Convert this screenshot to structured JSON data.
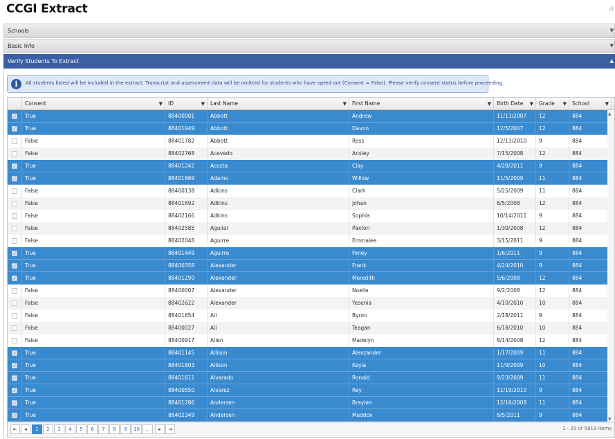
{
  "app": {
    "title": "CCGI Extract"
  },
  "sections": [
    {
      "label": "Schools"
    },
    {
      "label": "Basic Info"
    },
    {
      "label": "Verify Students To Extract"
    }
  ],
  "info": {
    "message": "All students listed will be included in the extract. Transcript and assessment data will be omitted for students who have opted out (Consent = False). Please verify consent status before proceeding."
  },
  "columns": [
    "Consent",
    "ID",
    "Last Name",
    "First Name",
    "Birth Date",
    "Grade",
    "School"
  ],
  "rows": [
    {
      "sel": true,
      "consent": "True",
      "id": "88400001",
      "last": "Abbott",
      "first": "Andrew",
      "birth": "11/11/2007",
      "grade": "12",
      "school": "884"
    },
    {
      "sel": true,
      "consent": "True",
      "id": "88401949",
      "last": "Abbott",
      "first": "Davon",
      "birth": "12/5/2007",
      "grade": "12",
      "school": "884"
    },
    {
      "sel": false,
      "consent": "False",
      "id": "88401782",
      "last": "Abbott",
      "first": "Ross",
      "birth": "12/13/2010",
      "grade": "9",
      "school": "884"
    },
    {
      "sel": false,
      "consent": "False",
      "id": "88402768",
      "last": "Acevedo",
      "first": "Ansley",
      "birth": "7/15/2008",
      "grade": "12",
      "school": "884"
    },
    {
      "sel": true,
      "consent": "True",
      "id": "88401242",
      "last": "Acosta",
      "first": "Clay",
      "birth": "4/28/2011",
      "grade": "9",
      "school": "884"
    },
    {
      "sel": true,
      "consent": "True",
      "id": "88401869",
      "last": "Adams",
      "first": "Willow",
      "birth": "11/5/2009",
      "grade": "11",
      "school": "884"
    },
    {
      "sel": false,
      "consent": "False",
      "id": "88400138",
      "last": "Adkins",
      "first": "Clark",
      "birth": "5/25/2009",
      "grade": "11",
      "school": "884"
    },
    {
      "sel": false,
      "consent": "False",
      "id": "88401692",
      "last": "Adkins",
      "first": "Johan",
      "birth": "8/5/2008",
      "grade": "12",
      "school": "884"
    },
    {
      "sel": false,
      "consent": "False",
      "id": "88402166",
      "last": "Adkins",
      "first": "Sophia",
      "birth": "10/14/2011",
      "grade": "9",
      "school": "884"
    },
    {
      "sel": false,
      "consent": "False",
      "id": "88402585",
      "last": "Aguilar",
      "first": "Paxton",
      "birth": "1/30/2008",
      "grade": "12",
      "school": "884"
    },
    {
      "sel": false,
      "consent": "False",
      "id": "88402048",
      "last": "Aguirre",
      "first": "Emmalee",
      "birth": "3/15/2011",
      "grade": "9",
      "school": "884"
    },
    {
      "sel": true,
      "consent": "True",
      "id": "88401449",
      "last": "Aguirre",
      "first": "Finley",
      "birth": "1/6/2011",
      "grade": "9",
      "school": "884"
    },
    {
      "sel": true,
      "consent": "True",
      "id": "88400358",
      "last": "Alexander",
      "first": "Frank",
      "birth": "4/24/2010",
      "grade": "9",
      "school": "884"
    },
    {
      "sel": true,
      "consent": "True",
      "id": "88401290",
      "last": "Alexander",
      "first": "Meredith",
      "birth": "5/6/2008",
      "grade": "12",
      "school": "884"
    },
    {
      "sel": false,
      "consent": "False",
      "id": "88400007",
      "last": "Alexander",
      "first": "Noelle",
      "birth": "9/2/2008",
      "grade": "12",
      "school": "884"
    },
    {
      "sel": false,
      "consent": "False",
      "id": "88402622",
      "last": "Alexander",
      "first": "Yesenia",
      "birth": "4/10/2010",
      "grade": "10",
      "school": "884"
    },
    {
      "sel": false,
      "consent": "False",
      "id": "88401654",
      "last": "Ali",
      "first": "Byron",
      "birth": "2/18/2011",
      "grade": "9",
      "school": "884"
    },
    {
      "sel": false,
      "consent": "False",
      "id": "88400027",
      "last": "Ali",
      "first": "Teagan",
      "birth": "6/18/2010",
      "grade": "10",
      "school": "884"
    },
    {
      "sel": false,
      "consent": "False",
      "id": "88400917",
      "last": "Allen",
      "first": "Madelyn",
      "birth": "8/14/2008",
      "grade": "12",
      "school": "884"
    },
    {
      "sel": true,
      "consent": "True",
      "id": "88401145",
      "last": "Allison",
      "first": "Alexzander",
      "birth": "1/17/2009",
      "grade": "11",
      "school": "884"
    },
    {
      "sel": true,
      "consent": "True",
      "id": "88401803",
      "last": "Allison",
      "first": "Keyla",
      "birth": "11/9/2009",
      "grade": "10",
      "school": "884"
    },
    {
      "sel": true,
      "consent": "True",
      "id": "88401611",
      "last": "Alvarado",
      "first": "Ronald",
      "birth": "9/23/2009",
      "grade": "11",
      "school": "884"
    },
    {
      "sel": true,
      "consent": "True",
      "id": "88400550",
      "last": "Alvarez",
      "first": "Rey",
      "birth": "11/19/2010",
      "grade": "9",
      "school": "884"
    },
    {
      "sel": true,
      "consent": "True",
      "id": "88401286",
      "last": "Andersen",
      "first": "Braylen",
      "birth": "12/16/2008",
      "grade": "11",
      "school": "884"
    },
    {
      "sel": true,
      "consent": "True",
      "id": "88402349",
      "last": "Andersen",
      "first": "Maddox",
      "birth": "8/5/2011",
      "grade": "9",
      "school": "884"
    }
  ],
  "pager": {
    "pages": [
      "1",
      "2",
      "3",
      "4",
      "5",
      "6",
      "7",
      "8",
      "9",
      "10",
      "..."
    ],
    "current": "1",
    "info": "1 - 25 of 5819 items"
  }
}
